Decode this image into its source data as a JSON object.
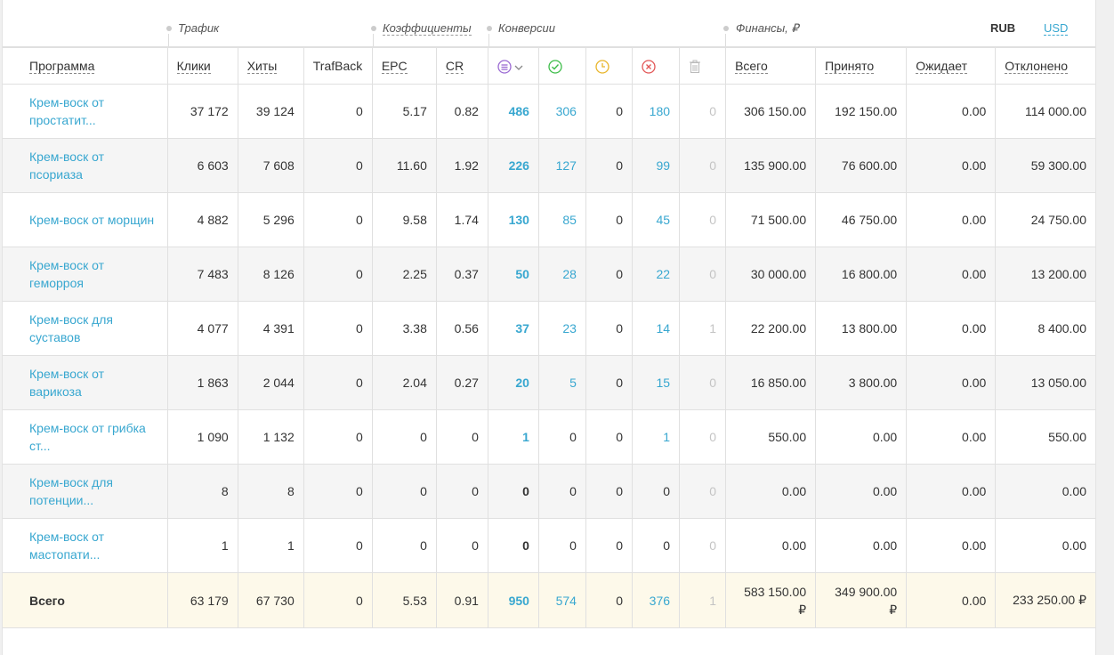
{
  "groups": {
    "traffic": "Трафик",
    "coeff": "Коэффициенты",
    "conv": "Конверсии",
    "finance": "Финансы, ₽"
  },
  "currency": {
    "rub": "RUB",
    "usd": "USD"
  },
  "headers": {
    "program": "Программа",
    "clicks": "Клики",
    "hits": "Хиты",
    "trafback": "TrafBack",
    "epc": "EPC",
    "cr": "CR",
    "total": "Всего",
    "accepted": "Принято",
    "pending": "Ожидает",
    "rejected": "Отклонено"
  },
  "icons": {
    "all": "list-circle-icon",
    "approved": "check-circle-icon",
    "hold": "clock-circle-icon",
    "cancel": "x-circle-icon",
    "trash": "trash-icon"
  },
  "rows": [
    {
      "name": "Крем-воск от простатит...",
      "name1": "Крем-воск от",
      "name2": "простатит...",
      "clicks": "37 172",
      "hits": "39 124",
      "tb": "0",
      "epc": "5.17",
      "cr": "0.82",
      "all": "486",
      "ok": "306",
      "hold": "0",
      "cancel": "180",
      "trash": "0",
      "total": "306 150.00",
      "accepted": "192 150.00",
      "pending": "0.00",
      "rejected": "114 000.00"
    },
    {
      "name1": "Крем-воск от",
      "name2": "псориаза",
      "clicks": "6 603",
      "hits": "7 608",
      "tb": "0",
      "epc": "11.60",
      "cr": "1.92",
      "all": "226",
      "ok": "127",
      "hold": "0",
      "cancel": "99",
      "trash": "0",
      "total": "135 900.00",
      "accepted": "76 600.00",
      "pending": "0.00",
      "rejected": "59 300.00"
    },
    {
      "name1": "Крем-воск от морщин",
      "name2": "",
      "clicks": "4 882",
      "hits": "5 296",
      "tb": "0",
      "epc": "9.58",
      "cr": "1.74",
      "all": "130",
      "ok": "85",
      "hold": "0",
      "cancel": "45",
      "trash": "0",
      "total": "71 500.00",
      "accepted": "46 750.00",
      "pending": "0.00",
      "rejected": "24 750.00"
    },
    {
      "name1": "Крем-воск от",
      "name2": "геморроя",
      "clicks": "7 483",
      "hits": "8 126",
      "tb": "0",
      "epc": "2.25",
      "cr": "0.37",
      "all": "50",
      "ok": "28",
      "hold": "0",
      "cancel": "22",
      "trash": "0",
      "total": "30 000.00",
      "accepted": "16 800.00",
      "pending": "0.00",
      "rejected": "13 200.00"
    },
    {
      "name1": "Крем-воск для",
      "name2": "суставов",
      "clicks": "4 077",
      "hits": "4 391",
      "tb": "0",
      "epc": "3.38",
      "cr": "0.56",
      "all": "37",
      "ok": "23",
      "hold": "0",
      "cancel": "14",
      "trash": "1",
      "total": "22 200.00",
      "accepted": "13 800.00",
      "pending": "0.00",
      "rejected": "8 400.00"
    },
    {
      "name1": "Крем-воск от",
      "name2": "варикоза",
      "clicks": "1 863",
      "hits": "2 044",
      "tb": "0",
      "epc": "2.04",
      "cr": "0.27",
      "all": "20",
      "ok": "5",
      "hold": "0",
      "cancel": "15",
      "trash": "0",
      "total": "16 850.00",
      "accepted": "3 800.00",
      "pending": "0.00",
      "rejected": "13 050.00"
    },
    {
      "name1": "Крем-воск от грибка",
      "name2": "ст...",
      "clicks": "1 090",
      "hits": "1 132",
      "tb": "0",
      "epc": "0",
      "cr": "0",
      "all": "1",
      "ok": "0",
      "hold": "0",
      "cancel": "1",
      "trash": "0",
      "total": "550.00",
      "accepted": "0.00",
      "pending": "0.00",
      "rejected": "550.00"
    },
    {
      "name1": "Крем-воск для",
      "name2": "потенции...",
      "clicks": "8",
      "hits": "8",
      "tb": "0",
      "epc": "0",
      "cr": "0",
      "all": "0",
      "ok": "0",
      "hold": "0",
      "cancel": "0",
      "trash": "0",
      "total": "0.00",
      "accepted": "0.00",
      "pending": "0.00",
      "rejected": "0.00"
    },
    {
      "name1": "Крем-воск от",
      "name2": "мастопати...",
      "clicks": "1",
      "hits": "1",
      "tb": "0",
      "epc": "0",
      "cr": "0",
      "all": "0",
      "ok": "0",
      "hold": "0",
      "cancel": "0",
      "trash": "0",
      "total": "0.00",
      "accepted": "0.00",
      "pending": "0.00",
      "rejected": "0.00"
    }
  ],
  "totals": {
    "label": "Всего",
    "clicks": "63 179",
    "hits": "67 730",
    "tb": "0",
    "epc": "5.53",
    "cr": "0.91",
    "all": "950",
    "ok": "574",
    "hold": "0",
    "cancel": "376",
    "trash": "1",
    "total1": "583 150.00",
    "total2": "₽",
    "accepted1": "349 900.00",
    "accepted2": "₽",
    "pending": "0.00",
    "rejected": "233 250.00 ₽"
  },
  "colors": {
    "accent": "#38a7d0",
    "purple": "#9b6bd3",
    "green": "#3ebd4a",
    "yellow": "#e8b52a",
    "red": "#e25656",
    "total_bg": "#fdf9ea"
  }
}
